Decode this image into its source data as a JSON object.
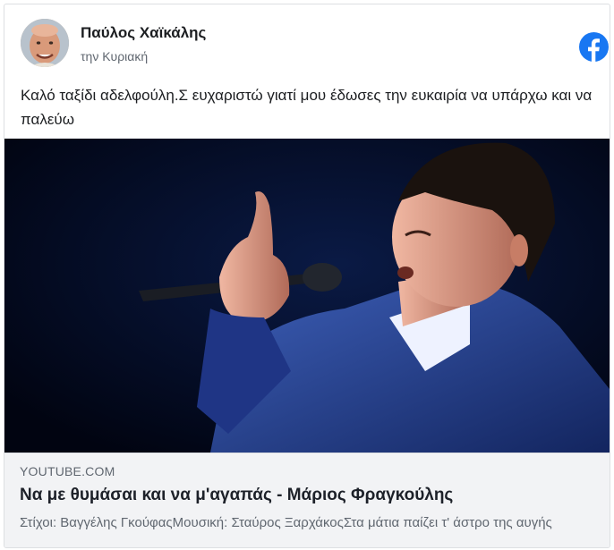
{
  "post": {
    "author": "Παύλος Χαϊκάλης",
    "timestamp": "την Κυριακή",
    "text": "Καλό ταξίδι αδελφούλη.Σ ευχαριστώ γιατί μου έδωσες την ευκαιρία να υπάρχω και να παλεύω",
    "avatar_icon": "avatar-photo",
    "platform_icon": "facebook-icon"
  },
  "link_preview": {
    "domain": "YOUTUBE.COM",
    "title": "Να με θυμάσαι και να μ'αγαπάς - Μάριος Φραγκούλης",
    "description": "Στίχοι: Βαγγέλης ΓκούφαςΜουσική: Σταύρος ΞαρχάκοςΣτα μάτια παίζει τ' άστρο της αυγής",
    "image": "singer-with-microphone-photo"
  },
  "colors": {
    "facebook_blue": "#1877f2",
    "text_primary": "#1c1e21",
    "text_secondary": "#606770",
    "preview_bg": "#f2f3f5"
  }
}
